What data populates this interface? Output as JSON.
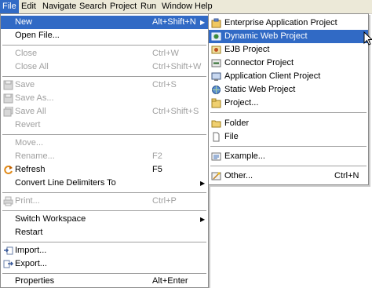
{
  "menubar": {
    "items": [
      "File",
      "Edit",
      "Navigate",
      "Search",
      "Project",
      "Run",
      "Window",
      "Help"
    ]
  },
  "file_menu": {
    "new": {
      "label": "New",
      "accel": "Alt+Shift+N"
    },
    "open_file": {
      "label": "Open File..."
    },
    "close": {
      "label": "Close",
      "accel": "Ctrl+W"
    },
    "close_all": {
      "label": "Close All",
      "accel": "Ctrl+Shift+W"
    },
    "save": {
      "label": "Save",
      "accel": "Ctrl+S"
    },
    "save_as": {
      "label": "Save As..."
    },
    "save_all": {
      "label": "Save All",
      "accel": "Ctrl+Shift+S"
    },
    "revert": {
      "label": "Revert"
    },
    "move": {
      "label": "Move..."
    },
    "rename": {
      "label": "Rename...",
      "accel": "F2"
    },
    "refresh": {
      "label": "Refresh",
      "accel": "F5"
    },
    "convert": {
      "label": "Convert Line Delimiters To"
    },
    "print": {
      "label": "Print...",
      "accel": "Ctrl+P"
    },
    "switch_workspace": {
      "label": "Switch Workspace"
    },
    "restart": {
      "label": "Restart"
    },
    "import": {
      "label": "Import..."
    },
    "export": {
      "label": "Export..."
    },
    "properties": {
      "label": "Properties",
      "accel": "Alt+Enter"
    }
  },
  "new_submenu": {
    "enterprise_app": {
      "label": "Enterprise Application Project"
    },
    "dynamic_web": {
      "label": "Dynamic Web Project"
    },
    "ejb": {
      "label": "EJB Project"
    },
    "connector": {
      "label": "Connector Project"
    },
    "app_client": {
      "label": "Application Client Project"
    },
    "static_web": {
      "label": "Static Web Project"
    },
    "project": {
      "label": "Project..."
    },
    "folder": {
      "label": "Folder"
    },
    "file": {
      "label": "File"
    },
    "example": {
      "label": "Example..."
    },
    "other": {
      "label": "Other...",
      "accel": "Ctrl+N"
    }
  },
  "colors": {
    "highlight": "#316ac5",
    "menubar_bg": "#ece9d8",
    "disabled_text": "#a0a0a0"
  },
  "icons": {
    "refresh": "refresh-icon",
    "import": "import-icon",
    "export": "export-icon",
    "folder": "folder-icon",
    "file": "file-icon",
    "example": "example-icon",
    "other": "wizard-icon"
  }
}
